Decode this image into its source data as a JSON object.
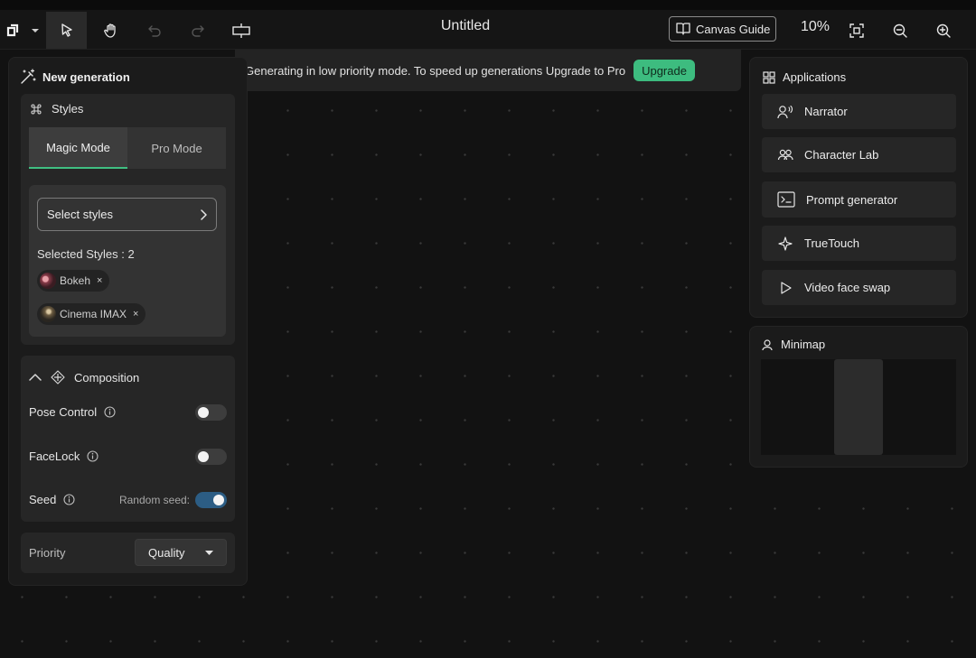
{
  "toolbar": {
    "title": "Untitled",
    "canvas_guide_label": "Canvas Guide",
    "zoom": "10%",
    "icons": [
      "logo-icon",
      "chevron-down-icon",
      "pointer-icon",
      "hand-icon",
      "undo-icon",
      "redo-icon",
      "frame-icon",
      "book-icon",
      "fit-screen-icon",
      "zoom-out-icon",
      "zoom-in-icon"
    ]
  },
  "notice": {
    "text": "Generating in low priority mode. To speed up generations Upgrade to Pro",
    "upgrade_label": "Upgrade",
    "upgrade_color": "#3dbc7f"
  },
  "left_panel": {
    "title": "New generation",
    "styles": {
      "title": "Styles",
      "tabs": [
        {
          "label": "Magic Mode",
          "active": true
        },
        {
          "label": "Pro Mode",
          "active": false
        }
      ],
      "select_label": "Select styles",
      "selected_count": "Selected Styles : 2",
      "chips": [
        {
          "label": "Bokeh",
          "remove": "×"
        },
        {
          "label": "Cinema IMAX",
          "remove": "×"
        }
      ]
    },
    "composition": {
      "title": "Composition",
      "pose_control": {
        "label": "Pose Control",
        "on": false
      },
      "facelock": {
        "label": "FaceLock",
        "on": false
      },
      "seed": {
        "label": "Seed",
        "random_label": "Random seed:",
        "on": true
      }
    },
    "priority": {
      "label": "Priority",
      "value": "Quality"
    }
  },
  "applications": {
    "title": "Applications",
    "items": [
      {
        "label": "Narrator",
        "icon": "narrator-icon"
      },
      {
        "label": "Character Lab",
        "icon": "character-lab-icon"
      },
      {
        "label": "Prompt generator",
        "icon": "terminal-icon"
      },
      {
        "label": "TrueTouch",
        "icon": "sparkle-icon"
      },
      {
        "label": "Video face swap",
        "icon": "play-icon"
      }
    ]
  },
  "minimap": {
    "title": "Minimap"
  },
  "colors": {
    "accent_green": "#3fbf82",
    "toggle_on": "#2c5d84",
    "canvas_bg": "#121212"
  }
}
